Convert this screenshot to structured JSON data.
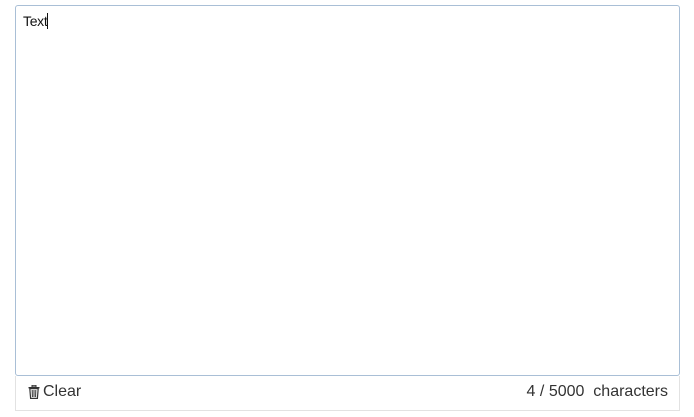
{
  "editor": {
    "value": "Text"
  },
  "footer": {
    "clear_label": "Clear",
    "clear_icon": "trash-icon",
    "count": "4",
    "separator": "/",
    "max": "5000",
    "unit_label": "characters"
  }
}
